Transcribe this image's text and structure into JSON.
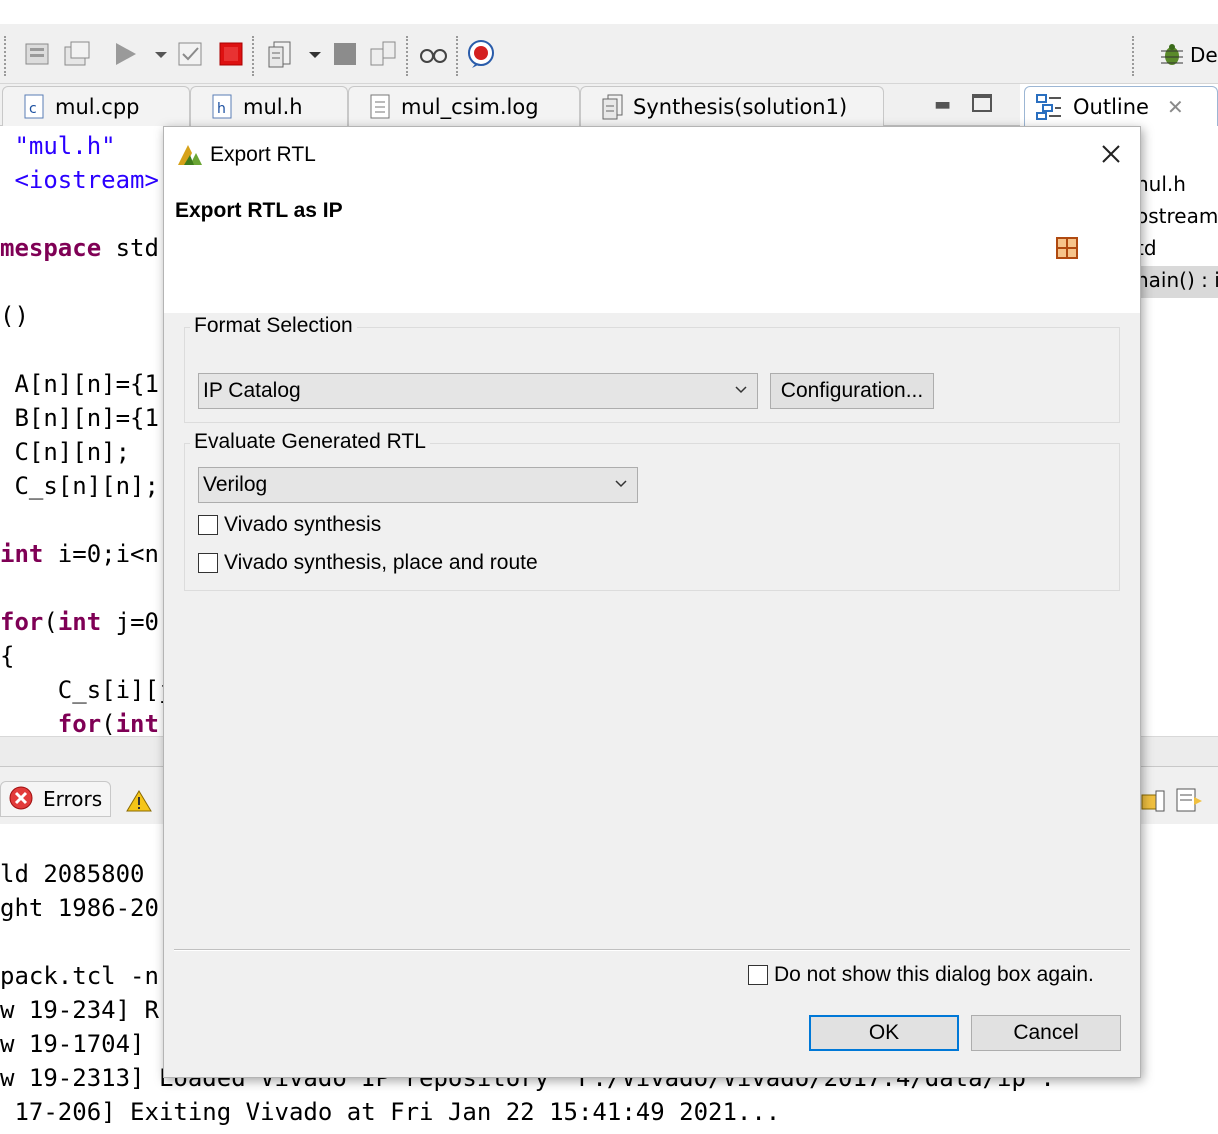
{
  "ide": {
    "editor_tabs": [
      "mul.cpp",
      "mul.h",
      "mul_csim.log",
      "Synthesis(solution1)"
    ],
    "outline_tab_label": "Outline",
    "perspective_label": "De",
    "outline_items": [
      "nul.h",
      "ostream",
      "td",
      "nain() : i"
    ],
    "code_lines": [
      {
        "parts": [
          {
            "t": " ",
            "c": ""
          },
          {
            "t": "\"mul.h\"",
            "c": "str"
          }
        ]
      },
      {
        "parts": [
          {
            "t": " ",
            "c": ""
          },
          {
            "t": "<iostream>",
            "c": "str"
          }
        ]
      },
      {
        "parts": [
          {
            "t": "",
            "c": ""
          }
        ]
      },
      {
        "parts": [
          {
            "t": "mespace",
            "c": "kw"
          },
          {
            "t": " std",
            "c": ""
          }
        ]
      },
      {
        "parts": [
          {
            "t": "",
            "c": ""
          }
        ]
      },
      {
        "parts": [
          {
            "t": "()",
            "c": ""
          }
        ]
      },
      {
        "parts": [
          {
            "t": "",
            "c": ""
          }
        ]
      },
      {
        "parts": [
          {
            "t": " A[n][n]={1",
            "c": ""
          }
        ]
      },
      {
        "parts": [
          {
            "t": " B[n][n]={1",
            "c": ""
          }
        ]
      },
      {
        "parts": [
          {
            "t": " C[n][n];",
            "c": ""
          }
        ]
      },
      {
        "parts": [
          {
            "t": " C_s[n][n];",
            "c": ""
          }
        ]
      },
      {
        "parts": [
          {
            "t": "",
            "c": ""
          }
        ]
      },
      {
        "parts": [
          {
            "t": "int",
            "c": "kw"
          },
          {
            "t": " i=0;i<n",
            "c": ""
          }
        ]
      },
      {
        "parts": [
          {
            "t": "",
            "c": ""
          }
        ]
      },
      {
        "parts": [
          {
            "t": "for",
            "c": "kw"
          },
          {
            "t": "(",
            "c": ""
          },
          {
            "t": "int",
            "c": "kw"
          },
          {
            "t": " j=0",
            "c": ""
          }
        ]
      },
      {
        "parts": [
          {
            "t": "{",
            "c": ""
          }
        ]
      },
      {
        "parts": [
          {
            "t": "    C_s[i][j",
            "c": ""
          }
        ]
      },
      {
        "parts": [
          {
            "t": "    ",
            "c": ""
          },
          {
            "t": "for",
            "c": "kw"
          },
          {
            "t": "(",
            "c": ""
          },
          {
            "t": "int",
            "c": "kw"
          }
        ]
      }
    ],
    "console_tab_label": "Errors",
    "console_lines": [
      "ld 2085800 ",
      "ght 1986-20",
      "",
      "pack.tcl -n",
      "w 19-234] R",
      "w 19-1704] ",
      "w 19-2313] Loaded Vivado IP repository 'F:/Vivado/Vivado/2017.4/data/ip'.",
      " 17-206] Exiting Vivado at Fri Jan 22 15:41:49 2021..."
    ]
  },
  "dialog": {
    "title": "Export RTL",
    "subtitle": "Export RTL as IP",
    "format_group_label": "Format Selection",
    "format_selected": "IP Catalog",
    "configuration_button": "Configuration...",
    "evaluate_group_label": "Evaluate Generated RTL",
    "language_selected": "Verilog",
    "vivado_synthesis_label": "Vivado synthesis",
    "vivado_synthesis_checked": false,
    "vivado_pnr_label": "Vivado synthesis, place and route",
    "vivado_pnr_checked": false,
    "dont_show_label": "Do not show this dialog box again.",
    "dont_show_checked": false,
    "ok_button": "OK",
    "cancel_button": "Cancel",
    "default_button_color": "#0078d7"
  }
}
